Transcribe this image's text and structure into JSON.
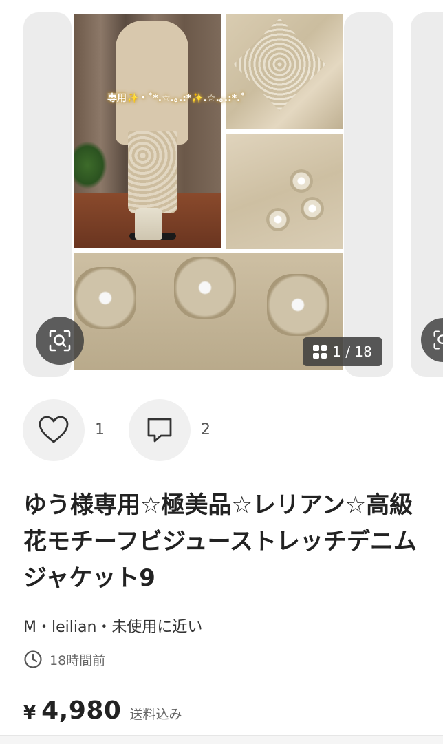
{
  "gallery": {
    "overlay_text": "専用✨・˚*.☆.｡.:*✨.☆.｡.:*.˚",
    "counter_label": "1 / 18",
    "current_index": 1,
    "total_images": 18
  },
  "actions": {
    "like_count": "1",
    "comment_count": "2"
  },
  "item": {
    "title": "ゆう様専用☆極美品☆レリアン☆高級花モチーフビジューストレッチデニムジャケット9",
    "meta": "M・leilian・未使用に近い",
    "posted": "18時間前",
    "currency": "¥",
    "price": "4,980",
    "shipping": "送料込み"
  },
  "icons": {
    "zoom": "zoom-scan-icon",
    "grid": "grid-icon",
    "like": "heart-icon",
    "comment": "comment-icon",
    "time": "clock-icon"
  },
  "colors": {
    "overlay_button": "#3c3c3c",
    "action_circle": "#f0f0f0",
    "text_primary": "#222222",
    "text_secondary": "#666666"
  }
}
